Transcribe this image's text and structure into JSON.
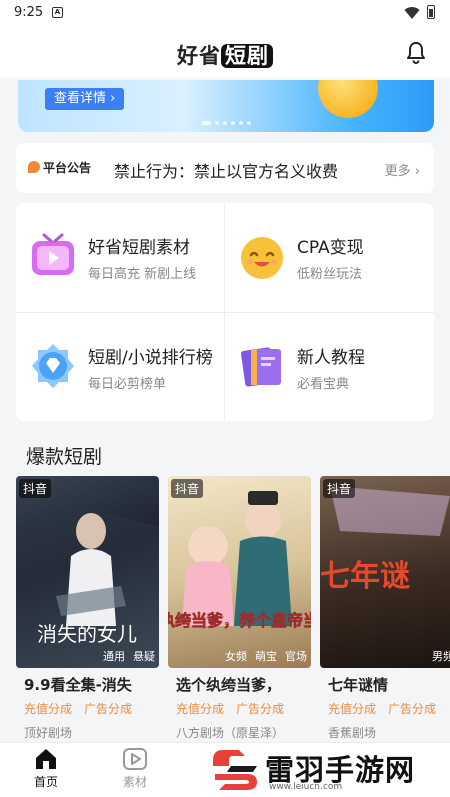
{
  "status_bar": {
    "time": "9:25",
    "notification_glyph": "A"
  },
  "header": {
    "title_part1": "好省",
    "title_part2": "短剧",
    "bell_icon": "bell-icon"
  },
  "banner": {
    "button_label": "查看详情 ›",
    "slide_count": 6,
    "active_slide": 0
  },
  "notice": {
    "tag": "平台公告",
    "text": "禁止行为：禁止以官方名义收费",
    "more": "更多 ›"
  },
  "features": [
    {
      "title": "好省短剧素材",
      "subtitle": "每日高充 新剧上线",
      "icon": "tv-play-icon",
      "color": "#d86cf0"
    },
    {
      "title": "CPA变现",
      "subtitle": "低粉丝玩法",
      "icon": "smiley-coin-icon",
      "color": "#f7c23a"
    },
    {
      "title": "短剧/小说排行榜",
      "subtitle": "每日必剪榜单",
      "icon": "diamond-badge-icon",
      "color": "#4aa3f5"
    },
    {
      "title": "新人教程",
      "subtitle": "必看宝典",
      "icon": "books-icon",
      "color": "#9b6ef0"
    }
  ],
  "section": {
    "title": "爆款短剧"
  },
  "dramas": [
    {
      "platform": "抖音",
      "poster_text": "消失的女儿",
      "poster_tags": [
        "通用",
        "悬疑"
      ],
      "name": "9.9看全集-消失",
      "tags": [
        "充值分成",
        "广告分成"
      ],
      "theater": "顶好剧场"
    },
    {
      "platform": "抖音",
      "poster_text": "选个纨绔当爹，养个皇帝当儿子",
      "poster_tags": [
        "女频",
        "萌宝",
        "官场"
      ],
      "name": "选个纨绔当爹，",
      "tags": [
        "充值分成",
        "广告分成"
      ],
      "theater": "八方剧场（原星泽）"
    },
    {
      "platform": "抖音",
      "poster_text": "七年谜",
      "poster_tags": [
        "男频"
      ],
      "name": "七年谜情",
      "tags": [
        "充值分成",
        "广告分成"
      ],
      "theater": "香蕉剧场"
    }
  ],
  "tabs": [
    {
      "label": "首页",
      "icon": "home-icon",
      "active": true
    },
    {
      "label": "素材",
      "icon": "play-square-icon",
      "active": false
    }
  ],
  "watermark": {
    "text": "雷羽手游网",
    "url": "www.leiucn.com"
  }
}
